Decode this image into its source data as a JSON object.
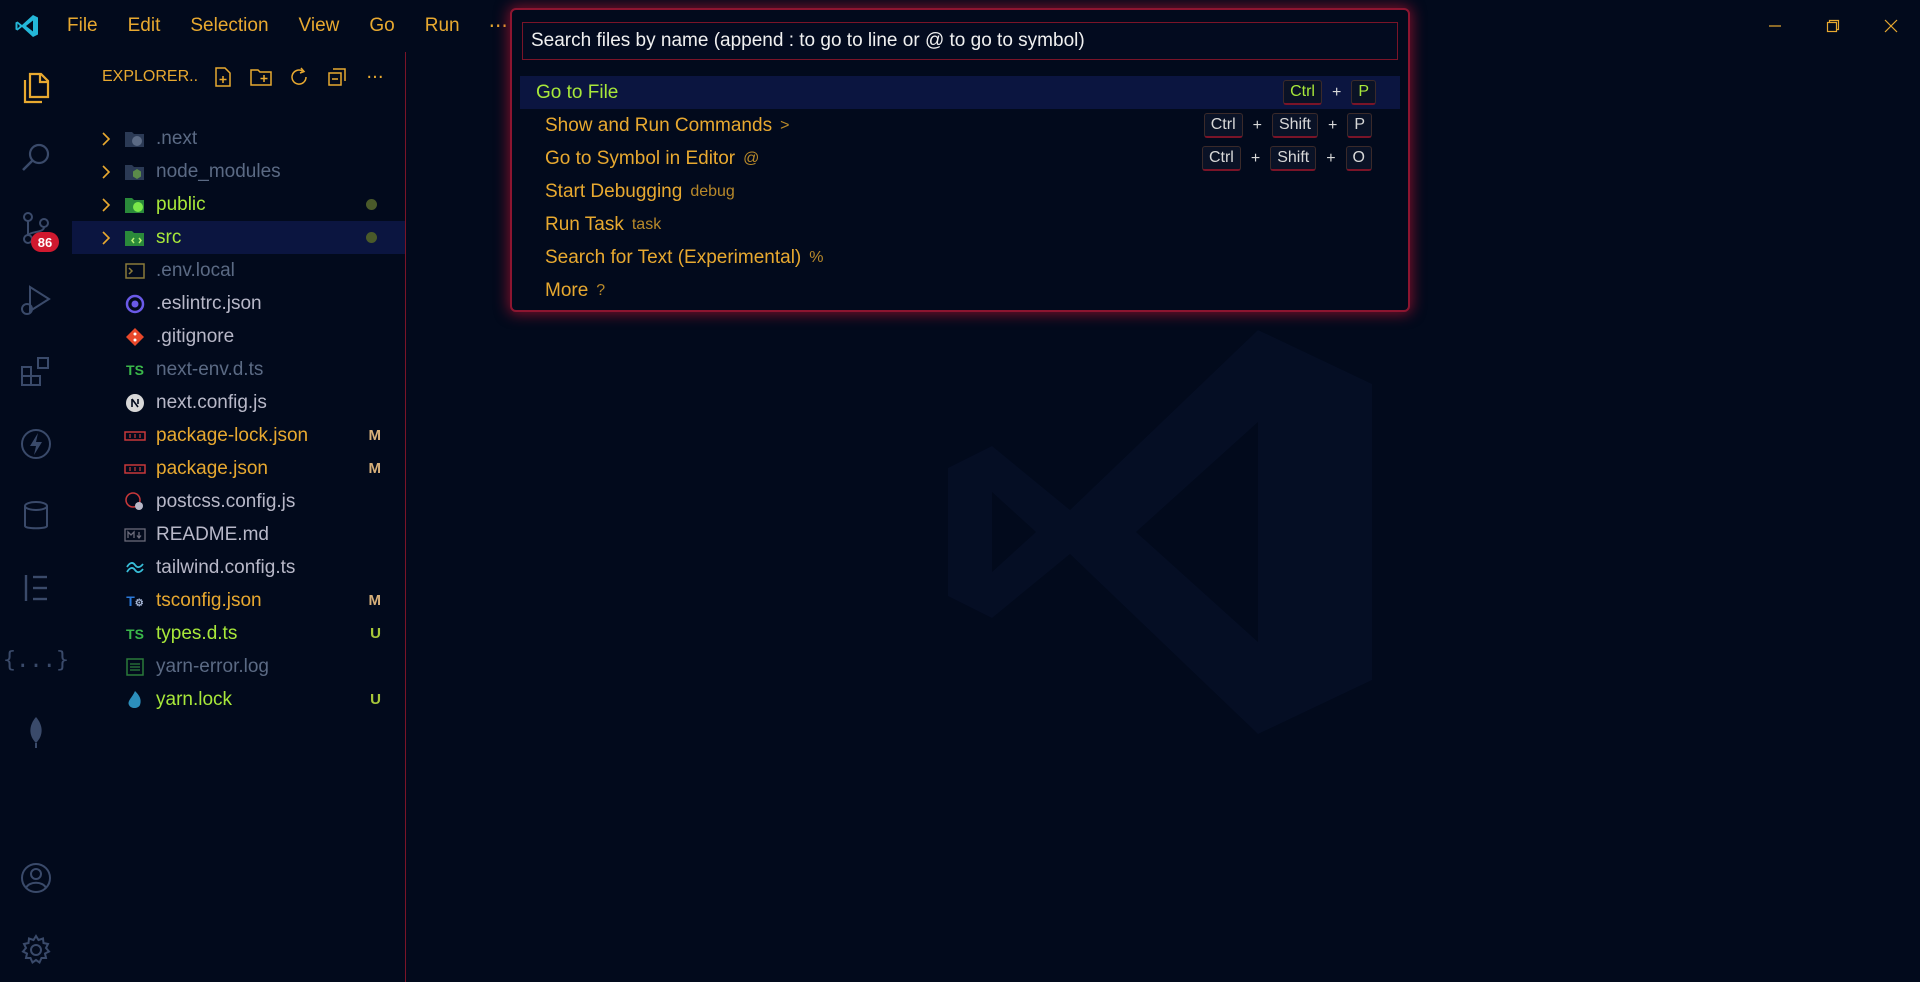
{
  "menu": {
    "items": [
      "File",
      "Edit",
      "Selection",
      "View",
      "Go",
      "Run"
    ],
    "more": "···"
  },
  "activity_badge": "86",
  "explorer": {
    "title": "EXPLORER...",
    "items": [
      {
        "name": ".next",
        "type": "folder",
        "color": "#5b6a84",
        "icon": "next-folder-icon",
        "deco": ""
      },
      {
        "name": "node_modules",
        "type": "folder",
        "color": "#5b6a84",
        "icon": "node-folder-icon",
        "deco": ""
      },
      {
        "name": "public",
        "type": "folder",
        "color": "#a8e83a",
        "icon": "public-folder-icon",
        "deco": "dot"
      },
      {
        "name": "src",
        "type": "folder",
        "color": "#a8e83a",
        "icon": "src-folder-icon",
        "deco": "dot"
      },
      {
        "name": ".env.local",
        "type": "file",
        "color": "#5b6a84",
        "icon": "terminal-file-icon",
        "deco": ""
      },
      {
        "name": ".eslintrc.json",
        "type": "file",
        "color": "#b8b8c8",
        "icon": "eslint-icon",
        "deco": ""
      },
      {
        "name": ".gitignore",
        "type": "file",
        "color": "#b8b8c8",
        "icon": "git-icon",
        "deco": ""
      },
      {
        "name": "next-env.d.ts",
        "type": "file",
        "color": "#5b6a84",
        "icon": "typescript-icon",
        "deco": ""
      },
      {
        "name": "next.config.js",
        "type": "file",
        "color": "#b8b8c8",
        "icon": "nextjs-icon",
        "deco": ""
      },
      {
        "name": "package-lock.json",
        "type": "file",
        "color": "#e8a930",
        "icon": "npm-icon",
        "deco": "M"
      },
      {
        "name": "package.json",
        "type": "file",
        "color": "#e8a930",
        "icon": "npm-icon",
        "deco": "M"
      },
      {
        "name": "postcss.config.js",
        "type": "file",
        "color": "#b8b8c8",
        "icon": "postcss-icon",
        "deco": ""
      },
      {
        "name": "README.md",
        "type": "file",
        "color": "#b8b8c8",
        "icon": "markdown-icon",
        "deco": ""
      },
      {
        "name": "tailwind.config.ts",
        "type": "file",
        "color": "#b8b8c8",
        "icon": "tailwind-icon",
        "deco": ""
      },
      {
        "name": "tsconfig.json",
        "type": "file",
        "color": "#e8a930",
        "icon": "tsconfig-icon",
        "deco": "M"
      },
      {
        "name": "types.d.ts",
        "type": "file",
        "color": "#a8e83a",
        "icon": "typescript-icon",
        "deco": "U"
      },
      {
        "name": "yarn-error.log",
        "type": "file",
        "color": "#5b6a84",
        "icon": "log-icon",
        "deco": ""
      },
      {
        "name": "yarn.lock",
        "type": "file",
        "color": "#a8e83a",
        "icon": "yarn-icon",
        "deco": "U"
      }
    ]
  },
  "palette": {
    "placeholder": "Search files by name (append : to go to line or @ to go to symbol)",
    "items": [
      {
        "label": "Go to File",
        "prefix": "",
        "keys": [
          "Ctrl",
          "P"
        ]
      },
      {
        "label": "Show and Run Commands",
        "prefix": ">",
        "keys": [
          "Ctrl",
          "Shift",
          "P"
        ]
      },
      {
        "label": "Go to Symbol in Editor",
        "prefix": "@",
        "keys": [
          "Ctrl",
          "Shift",
          "O"
        ]
      },
      {
        "label": "Start Debugging",
        "prefix": "debug",
        "keys": []
      },
      {
        "label": "Run Task",
        "prefix": "task",
        "keys": []
      },
      {
        "label": "Search for Text (Experimental)",
        "prefix": "%",
        "keys": []
      },
      {
        "label": "More",
        "prefix": "?",
        "keys": []
      }
    ]
  },
  "colors": {
    "accent": "#e8a930",
    "modified": "#d7b07a",
    "untracked": "#a8c83a",
    "border": "#8c1530"
  }
}
